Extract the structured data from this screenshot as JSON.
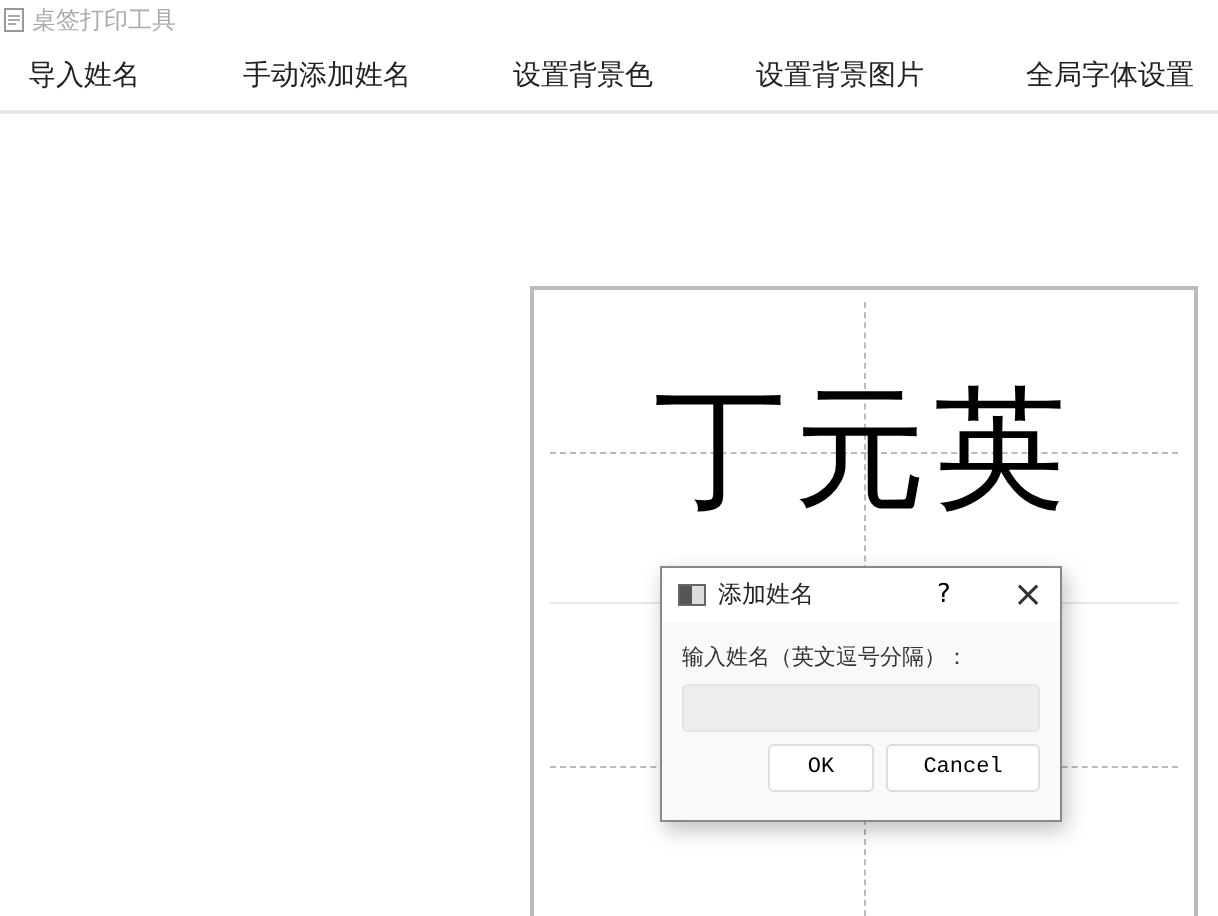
{
  "window": {
    "title": "桌签打印工具"
  },
  "menu": [
    {
      "label": "导入姓名"
    },
    {
      "label": "手动添加姓名"
    },
    {
      "label": "设置背景色"
    },
    {
      "label": "设置背景图片"
    },
    {
      "label": "全局字体设置"
    }
  ],
  "card": {
    "name": "丁元英"
  },
  "dialog": {
    "title": "添加姓名",
    "help": "?",
    "close": "×",
    "prompt": "输入姓名（英文逗号分隔）：",
    "buttons": [
      "OK",
      "Cancel"
    ]
  }
}
